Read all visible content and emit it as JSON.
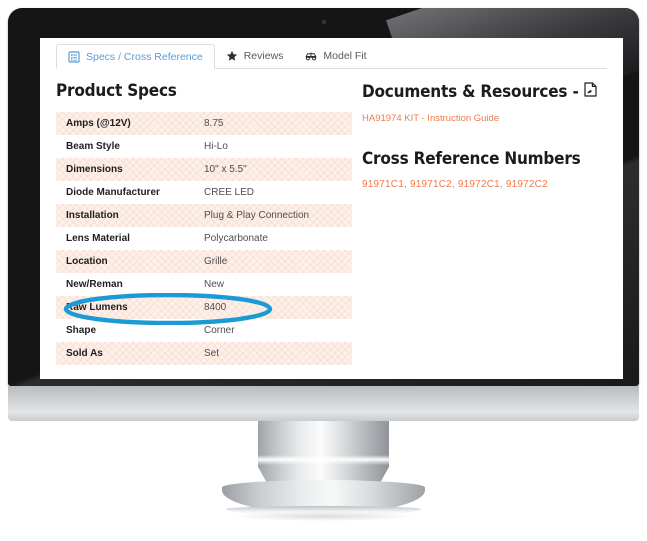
{
  "tabs": [
    {
      "label": "Specs / Cross Reference",
      "icon": "list-document-icon",
      "active": true
    },
    {
      "label": "Reviews",
      "icon": "star-icon",
      "active": false
    },
    {
      "label": "Model Fit",
      "icon": "vehicle-icon",
      "active": false
    }
  ],
  "left": {
    "heading": "Product Specs",
    "specs": [
      {
        "key": "Amps (@12V)",
        "value": "8.75"
      },
      {
        "key": "Beam Style",
        "value": "Hi-Lo"
      },
      {
        "key": "Dimensions",
        "value": "10\" x 5.5\""
      },
      {
        "key": "Diode Manufacturer",
        "value": "CREE LED"
      },
      {
        "key": "Installation",
        "value": "Plug & Play Connection"
      },
      {
        "key": "Lens Material",
        "value": "Polycarbonate"
      },
      {
        "key": "Location",
        "value": "Grille"
      },
      {
        "key": "New/Reman",
        "value": "New"
      },
      {
        "key": "Raw Lumens",
        "value": "8400"
      },
      {
        "key": "Shape",
        "value": "Corner"
      },
      {
        "key": "Sold As",
        "value": "Set"
      }
    ]
  },
  "right": {
    "documents_heading": "Documents & Resources -",
    "documents_icon": "pdf-document-icon",
    "document_link": "HA91974 KIT - Instruction Guide",
    "xref_heading": "Cross Reference Numbers",
    "xref_numbers": "91971C1,  91971C2,  91972C1,  91972C2"
  },
  "annotation": {
    "type": "ellipse-highlight",
    "targets": "Raw Lumens 8400",
    "color": "#1b9ad6"
  },
  "colors": {
    "tab_active_text": "#5b9bd5",
    "link_orange": "#f07a4a",
    "row_shade": "#fcf0e9",
    "bezel": "#151515",
    "stand": "#c9cccf"
  }
}
